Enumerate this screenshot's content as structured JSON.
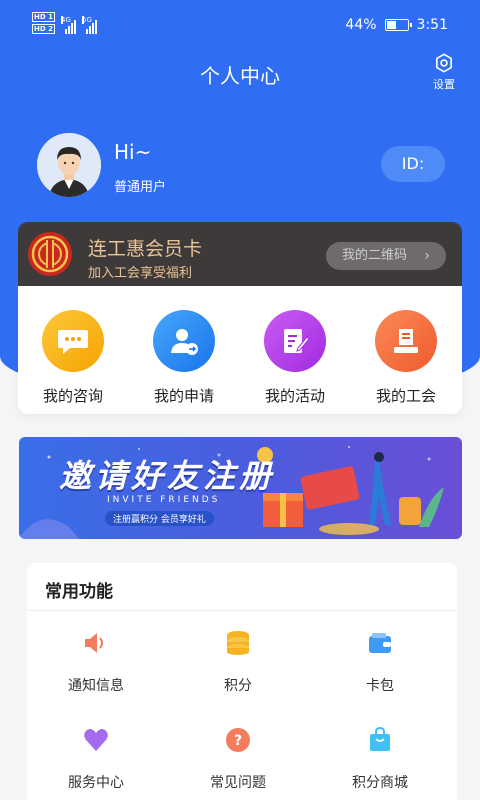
{
  "status_bar": {
    "hd1": "HD 1",
    "hd2": "HD 2",
    "net1": "4G",
    "net2": "5G",
    "battery": "44%",
    "battery_level": 0.44,
    "time": "3:51"
  },
  "header": {
    "title": "个人中心",
    "settings_label": "设置",
    "settings_icon": "gear-icon"
  },
  "profile": {
    "greeting": "Hi~",
    "user_type": "普通用户",
    "id_label": "ID:",
    "avatar_icon": "user-avatar"
  },
  "member_card": {
    "title": "连工惠会员卡",
    "subtitle": "加入工会享受福利",
    "qr_button": "我的二维码",
    "logo_icon": "union-emblem"
  },
  "quick_actions": [
    {
      "label": "我的咨询",
      "icon": "chat-bubble-icon",
      "color": "#f8b10e"
    },
    {
      "label": "我的申请",
      "icon": "user-apply-icon",
      "color": "#2d8cf5"
    },
    {
      "label": "我的活动",
      "icon": "edit-note-icon",
      "color": "#b53ee6"
    },
    {
      "label": "我的工会",
      "icon": "union-building-icon",
      "color": "#f36d3d"
    }
  ],
  "banner": {
    "title": "邀请好友注册",
    "subtitle": "INVITE FRIENDS",
    "tagline": "注册赢积分 会员享好礼"
  },
  "common_functions": {
    "title": "常用功能",
    "items": [
      {
        "label": "通知信息",
        "icon": "speaker-icon",
        "color": "#f47b5d"
      },
      {
        "label": "积分",
        "icon": "coins-icon",
        "color": "#f5b324"
      },
      {
        "label": "卡包",
        "icon": "wallet-icon",
        "color": "#3f9cf6"
      },
      {
        "label": "服务中心",
        "icon": "heart-icon",
        "color": "#a66cf0"
      },
      {
        "label": "常见问题",
        "icon": "question-icon",
        "color": "#f47b5d"
      },
      {
        "label": "积分商城",
        "icon": "shopping-bag-icon",
        "color": "#3ec2f5"
      }
    ]
  },
  "colors": {
    "primary": "#2f6ef3",
    "card_dark": "#3e3a39",
    "gold": "#e8c497"
  }
}
